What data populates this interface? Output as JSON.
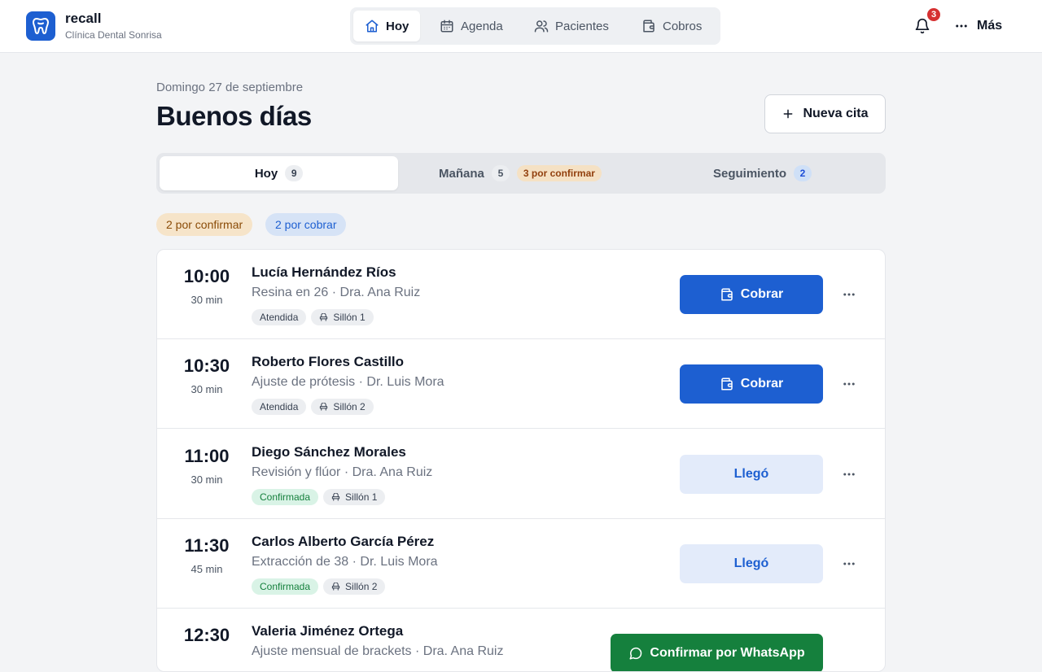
{
  "brand": {
    "name": "recall",
    "clinic": "Clínica Dental Sonrisa",
    "accent": "#1d5fd1"
  },
  "nav": {
    "items": [
      {
        "label": "Hoy",
        "icon": "home-icon",
        "active": true
      },
      {
        "label": "Agenda",
        "icon": "calendar-icon"
      },
      {
        "label": "Pacientes",
        "icon": "users-icon"
      },
      {
        "label": "Cobros",
        "icon": "wallet-icon"
      }
    ]
  },
  "header_actions": {
    "notifications_count": "3",
    "more_label": "Más"
  },
  "page": {
    "date": "Domingo 27 de septiembre",
    "greeting": "Buenos días",
    "new_button": "Nueva cita"
  },
  "tabs": [
    {
      "label": "Hoy",
      "count": "9",
      "active": true
    },
    {
      "label": "Mañana",
      "count": "5",
      "extra": "3 por confirmar"
    },
    {
      "label": "Seguimiento",
      "count": "2"
    }
  ],
  "filters": {
    "pending_confirm": "2 por confirmar",
    "pending_charge": "2 por cobrar"
  },
  "appointments": [
    {
      "time": "10:00",
      "duration": "30 min",
      "patient": "Lucía Hernández Ríos",
      "detail": "Resina en 26 · Dra. Ana Ruiz",
      "status": "Atendida",
      "chair": "Sillón 1",
      "action": "Cobrar"
    },
    {
      "time": "10:30",
      "duration": "30 min",
      "patient": "Roberto Flores Castillo",
      "detail": "Ajuste de prótesis · Dr. Luis Mora",
      "status": "Atendida",
      "chair": "Sillón 2",
      "action": "Cobrar"
    },
    {
      "time": "11:00",
      "duration": "30 min",
      "patient": "Diego Sánchez Morales",
      "detail": "Revisión y flúor · Dra. Ana Ruiz",
      "status": "Confirmada",
      "chair": "Sillón 1",
      "action": "Llegó"
    },
    {
      "time": "11:30",
      "duration": "45 min",
      "patient": "Carlos Alberto García Pérez",
      "detail": "Extracción de 38 · Dr. Luis Mora",
      "status": "Confirmada",
      "chair": "Sillón 2",
      "action": "Llegó"
    },
    {
      "time": "12:30",
      "duration": "",
      "patient": "Valeria Jiménez Ortega",
      "detail": "Ajuste mensual de brackets · Dra. Ana Ruiz",
      "status": "",
      "chair": "",
      "action": "Confirmar por WhatsApp"
    }
  ]
}
